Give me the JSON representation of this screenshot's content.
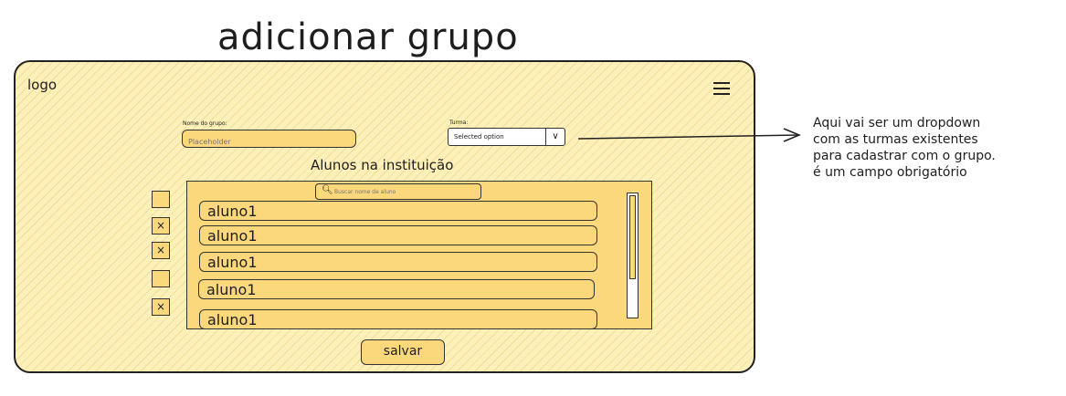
{
  "page_title": "adicionar grupo",
  "header": {
    "logo_text": "logo",
    "menu_icon": "hamburger-icon"
  },
  "form": {
    "group_name_label": "Nome do grupo:",
    "group_name_placeholder": "Placeholder",
    "turma_label": "Turma:",
    "turma_selected": "Selected option",
    "turma_dropdown_icon": "chevron-down-icon"
  },
  "students_section": {
    "title": "Alunos na instituição",
    "search_placeholder": "Buscar nome de aluno",
    "search_icon": "search-icon",
    "students": [
      {
        "name": "aluno1",
        "checked": false
      },
      {
        "name": "aluno1",
        "checked": true
      },
      {
        "name": "aluno1",
        "checked": true
      },
      {
        "name": "aluno1",
        "checked": false
      },
      {
        "name": "aluno1",
        "checked": true
      }
    ],
    "checkmark": "×"
  },
  "save_label": "salvar",
  "annotation": {
    "lines": [
      "Aqui vai ser um dropdown",
      "com as turmas existentes",
      "para cadastrar com o grupo.",
      "é um campo obrigatório"
    ]
  },
  "colors": {
    "fill": "#fcd87d",
    "background_hatch": "#fdf0b8",
    "stroke": "#1e1e1e"
  }
}
